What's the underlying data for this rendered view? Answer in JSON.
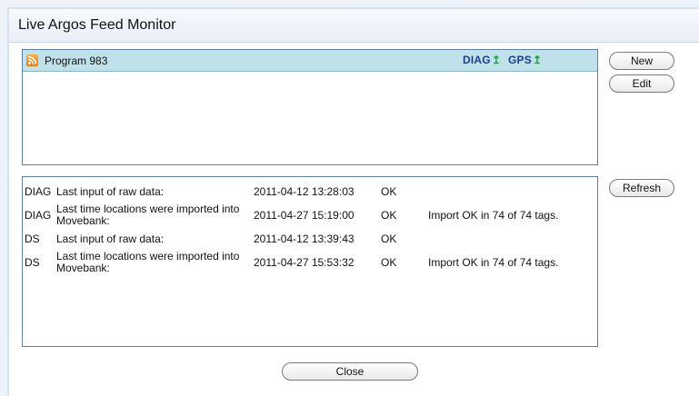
{
  "window": {
    "title": "Live Argos Feed Monitor"
  },
  "feeds": {
    "items": [
      {
        "name": "Program 983",
        "icon": "rss-icon",
        "badges": [
          "DIAG",
          "GPS"
        ]
      }
    ]
  },
  "buttons": {
    "new_label": "New",
    "edit_label": "Edit",
    "refresh_label": "Refresh",
    "close_label": "Close"
  },
  "status": {
    "rows": [
      {
        "source": "DIAG",
        "description": "Last input of raw data:",
        "time": "2011-04-12 13:28:03",
        "status": "OK",
        "note": ""
      },
      {
        "source": "DIAG",
        "description": "Last time locations were imported into Movebank:",
        "time": "2011-04-27 15:19:00",
        "status": "OK",
        "note": "Import OK in 74 of 74 tags."
      },
      {
        "source": "DS",
        "description": "Last input of raw data:",
        "time": "2011-04-12 13:39:43",
        "status": "OK",
        "note": ""
      },
      {
        "source": "DS",
        "description": "Last time locations were imported into Movebank:",
        "time": "2011-04-27 15:53:32",
        "status": "OK",
        "note": "Import OK in 74 of 74 tags."
      }
    ]
  },
  "colors": {
    "feed_row_bg": "#bfe2ea",
    "badge_text": "#1d3d91",
    "badge_arrow": "#1fa43a",
    "panel_border": "#5c7fa3"
  }
}
